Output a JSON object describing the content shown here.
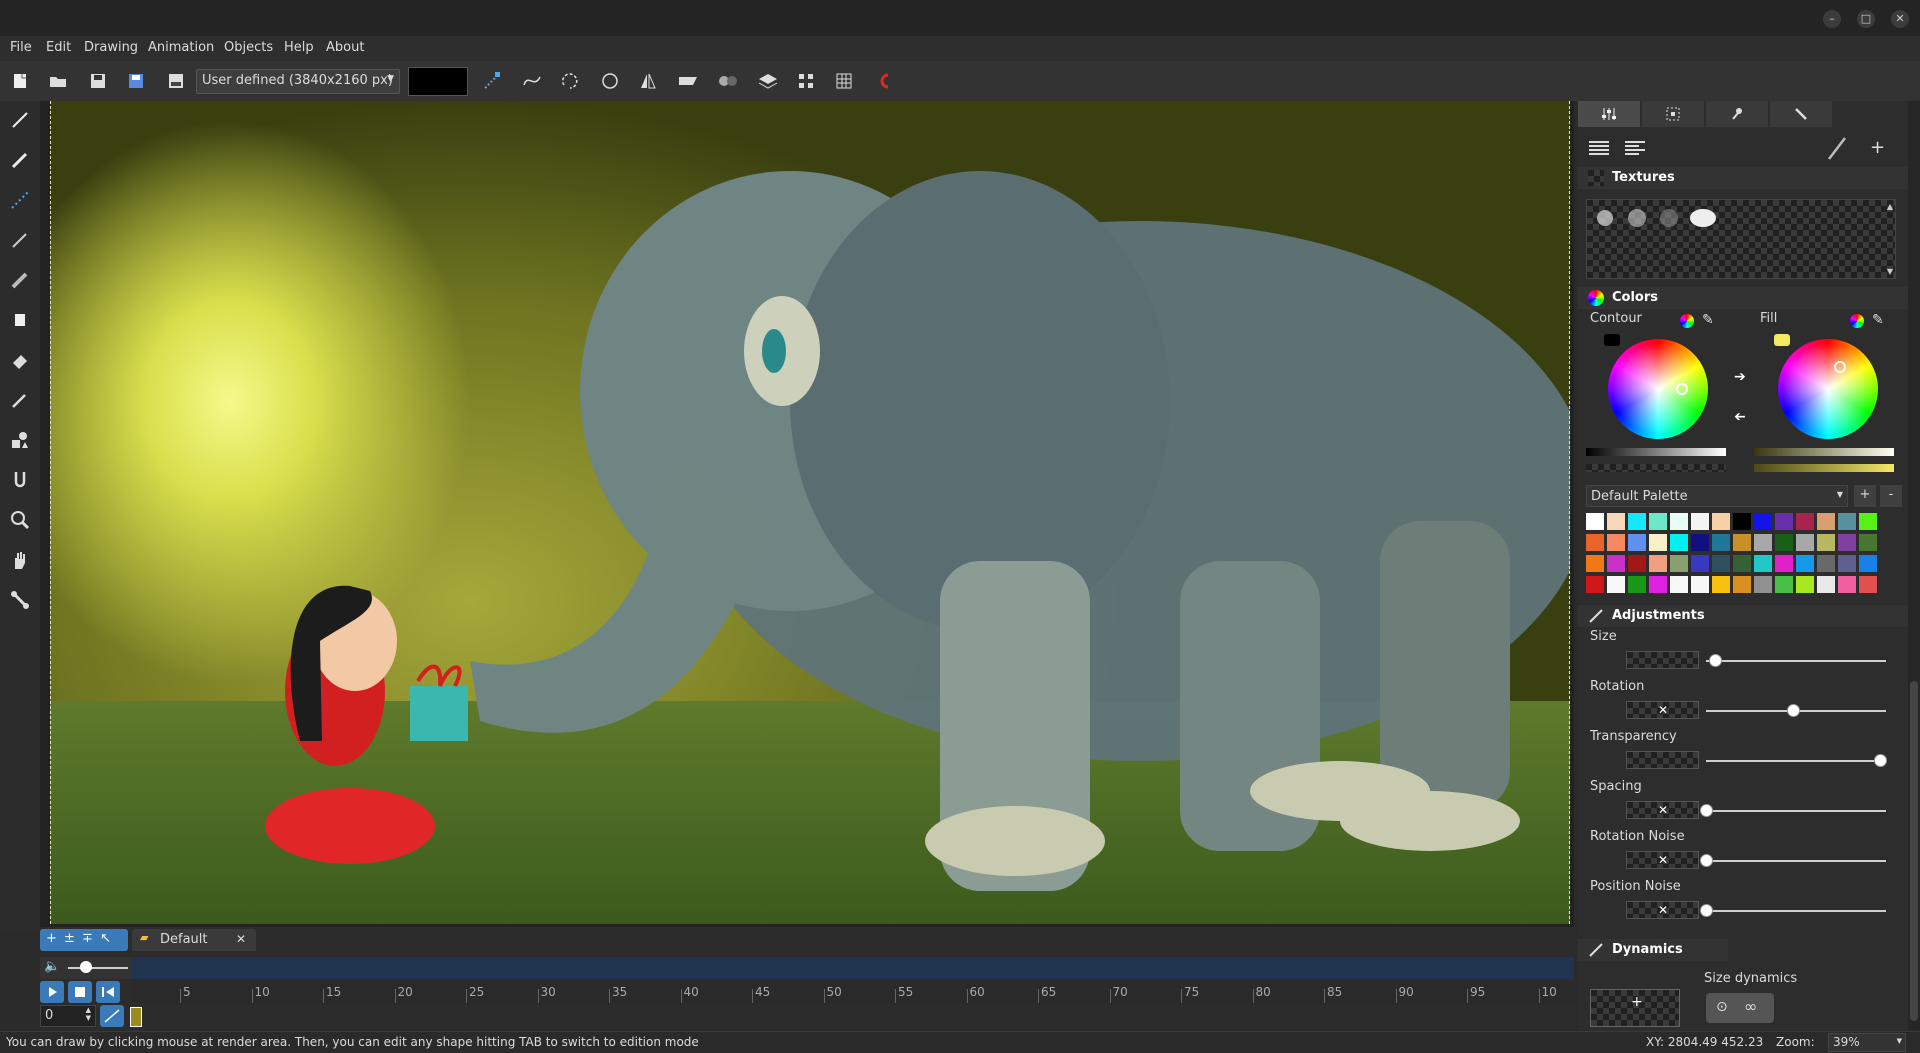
{
  "window": {
    "minimize": "–",
    "maximize": "□",
    "close": "✕"
  },
  "menu": [
    "File",
    "Edit",
    "Drawing",
    "Animation",
    "Objects",
    "Help",
    "About"
  ],
  "toolbar": {
    "size_preset": "User defined (3840x2160 px)",
    "current_color": "#000000",
    "icons": [
      "new-file-icon",
      "open-folder-icon",
      "save-icon",
      "save-as-icon",
      "export-png-icon",
      "node-edit-icon",
      "bezier-icon",
      "lasso-icon",
      "circle-icon",
      "mirror-icon",
      "perspective-icon",
      "blend-icon",
      "layers-icon",
      "transform-icon",
      "grid-icon",
      "magnet-icon"
    ]
  },
  "left_tools": [
    "pen-icon",
    "brush-icon",
    "line-icon",
    "pencil-icon",
    "marker-icon",
    "fill-bucket-icon",
    "eraser-icon",
    "eyedropper-icon",
    "shapes-icon",
    "smudge-icon",
    "zoom-icon",
    "hand-icon",
    "bone-icon"
  ],
  "panel": {
    "tabs": [
      "sliders-tab-icon",
      "selection-tab-icon",
      "pin-tab-icon",
      "tools-tab-icon"
    ],
    "textures": {
      "title": "Textures"
    },
    "colors": {
      "title": "Colors",
      "contour_label": "Contour",
      "fill_label": "Fill",
      "contour_color": "#000000",
      "fill_color": "#f3e967",
      "palette_name": "Default Palette",
      "palette_add": "+",
      "palette_remove": "-",
      "palette": [
        "#ffffff",
        "#f8d8b8",
        "#13e8ff",
        "#6ce8c8",
        "#e8fcf8",
        "#f4f4f4",
        "#f8d0a8",
        "#000000",
        "#1414e8",
        "#6830a8",
        "#a8244c",
        "#d8a070",
        "#5890a0",
        "#58f018",
        "#e86428",
        "#f88860",
        "#6090f0",
        "#f8f0c8",
        "#00f0f0",
        "#101080",
        "#207898",
        "#c89028",
        "#a8a8a8",
        "#186018",
        "#a8a8a8",
        "#b8b860",
        "#8040a0",
        "#487830",
        "#f07818",
        "#c830c8",
        "#a01818",
        "#f0a080",
        "#88a070",
        "#3838c0",
        "#305060",
        "#386038",
        "#20c8c8",
        "#e020c8",
        "#1898e8",
        "#686868",
        "#606090",
        "#1880e8",
        "#d01818",
        "#f8f8f8",
        "#189818",
        "#e020e0",
        "#f8f8f8",
        "#f8f8f8",
        "#f8c010",
        "#d89020",
        "#909090",
        "#48c048",
        "#a8e820",
        "#e8e8e8",
        "#f060a0",
        "#e05050"
      ]
    },
    "adjustments": {
      "title": "Adjustments",
      "items": [
        {
          "label": "Size",
          "value": 0.05,
          "mark": ""
        },
        {
          "label": "Rotation",
          "value": 0.5,
          "mark": "✕"
        },
        {
          "label": "Transparency",
          "value": 1.0,
          "mark": ""
        },
        {
          "label": "Spacing",
          "value": 0.0,
          "mark": "✕"
        },
        {
          "label": "Rotation Noise",
          "value": 0.0,
          "mark": "✕"
        },
        {
          "label": "Position Noise",
          "value": 0.0,
          "mark": "✕"
        }
      ]
    },
    "dynamics": {
      "title": "Dynamics",
      "size_dynamics": "Size dynamics",
      "preview_mark": "+"
    }
  },
  "timeline": {
    "layer_tab": "Default",
    "layer_close": "✕",
    "frame": "0",
    "ticks": [
      "5",
      "10",
      "15",
      "20",
      "25",
      "30",
      "35",
      "40",
      "45",
      "50",
      "55",
      "60",
      "65",
      "70",
      "75",
      "80",
      "85",
      "90",
      "95",
      "10"
    ]
  },
  "status": {
    "hint": "You can draw by clicking mouse at render area. Then, you can edit any shape hitting TAB to switch to edition mode",
    "coords": "XY: 2804.49 452.23",
    "zoom_label": "Zoom:",
    "zoom_value": "39%"
  }
}
